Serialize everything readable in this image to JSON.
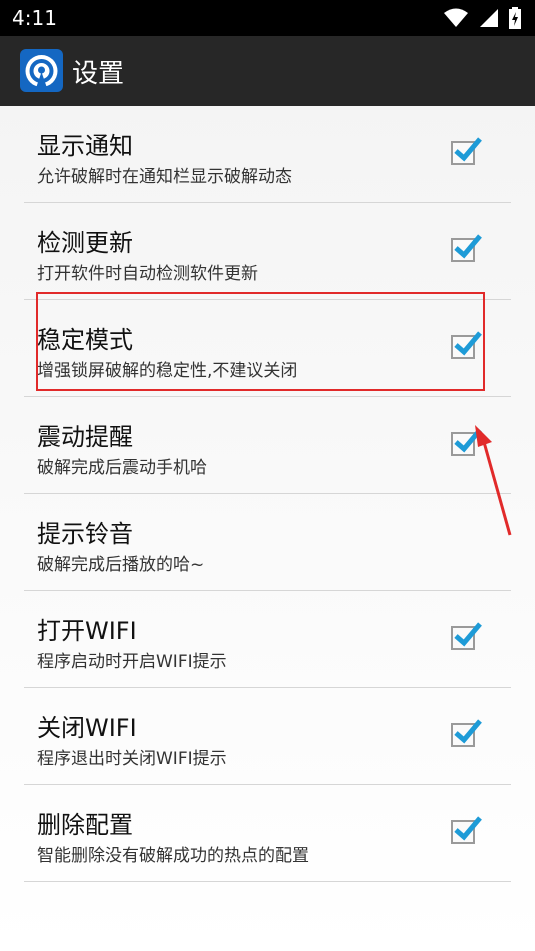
{
  "status_bar": {
    "time": "4:11"
  },
  "app_bar": {
    "title": "设置"
  },
  "settings": [
    {
      "title": "显示通知",
      "summary": "允许破解时在通知栏显示破解动态",
      "checked": true
    },
    {
      "title": "检测更新",
      "summary": "打开软件时自动检测软件更新",
      "checked": true
    },
    {
      "title": "稳定模式",
      "summary": "增强锁屏破解的稳定性,不建议关闭",
      "checked": true
    },
    {
      "title": "震动提醒",
      "summary": "破解完成后震动手机哈",
      "checked": true
    },
    {
      "title": "提示铃音",
      "summary": "破解完成后播放的哈~",
      "checked": false
    },
    {
      "title": "打开WIFI",
      "summary": "程序启动时开启WIFI提示",
      "checked": true
    },
    {
      "title": "关闭WIFI",
      "summary": "程序退出时关闭WIFI提示",
      "checked": true
    },
    {
      "title": "删除配置",
      "summary": "智能删除没有破解成功的热点的配置",
      "checked": true
    }
  ],
  "colors": {
    "check": "#1e9bd7",
    "highlight": "#e12a2a"
  },
  "icons": [
    "wifi-icon",
    "signal-icon",
    "battery-charging-icon",
    "app-logo-icon"
  ]
}
